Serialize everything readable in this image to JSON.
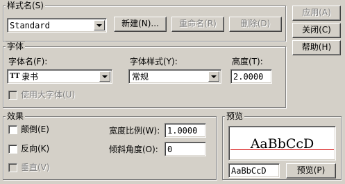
{
  "style_group": {
    "legend": "样式名(S)",
    "style_value": "Standard",
    "new_button": "新建(N)...",
    "rename_button": "重命名(R)",
    "delete_button": "删除(D)"
  },
  "side_buttons": {
    "apply": "应用(A)",
    "close": "关闭(C)",
    "help": "帮助(H)"
  },
  "font_group": {
    "legend": "字体",
    "font_name_label": "字体名(F):",
    "font_name_value": "隶书",
    "font_icon": "TT",
    "font_style_label": "字体样式(Y):",
    "font_style_value": "常规",
    "height_label": "高度(T):",
    "height_value": "2.0000",
    "big_font_label": "使用大字体(U)"
  },
  "effects_group": {
    "legend": "效果",
    "upside_down_label": "颠倒(E)",
    "backwards_label": "反向(K)",
    "vertical_label": "垂直(V)",
    "width_factor_label": "宽度比例(W):",
    "width_factor_value": "1.0000",
    "oblique_label": "倾斜角度(O):",
    "oblique_value": "0"
  },
  "preview_group": {
    "legend": "预览",
    "sample_text": "AaBbCcD",
    "preview_input_value": "AaBbCcD",
    "preview_button": "预览(P)"
  },
  "colors": {
    "face": "#d4d0c8",
    "preview_line": "#d40000"
  },
  "icons": [
    "truetype-font-icon",
    "dropdown-arrow-icon",
    "checkbox-icon"
  ]
}
